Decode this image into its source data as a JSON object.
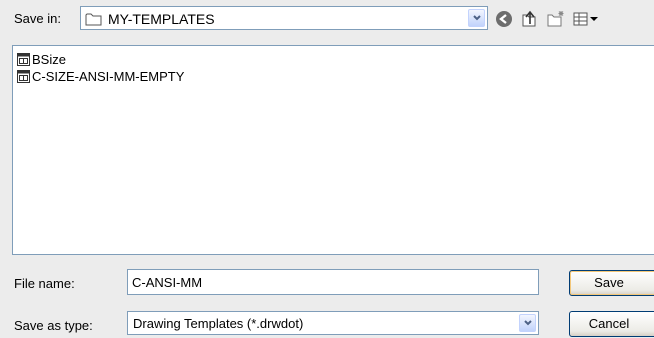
{
  "save_in": {
    "label": "Save in:",
    "value": "MY-TEMPLATES",
    "icon": "folder-icon"
  },
  "toolbar": {
    "back_icon": "back-arrow-icon",
    "up_icon": "up-folder-icon",
    "new_folder_icon": "new-folder-icon",
    "views_icon": "views-menu-icon"
  },
  "files": [
    {
      "name": "BSize",
      "icon": "drawing-template-icon"
    },
    {
      "name": "C-SIZE-ANSI-MM-EMPTY",
      "icon": "drawing-template-icon"
    }
  ],
  "file_name": {
    "label": "File name:",
    "value": "C-ANSI-MM"
  },
  "save_as_type": {
    "label": "Save as type:",
    "value": "Drawing Templates (*.drwdot)"
  },
  "buttons": {
    "save": "Save",
    "cancel": "Cancel"
  },
  "colors": {
    "field_border": "#7f9db9",
    "dialog_bg": "#ececec",
    "button_border": "#003c74"
  }
}
